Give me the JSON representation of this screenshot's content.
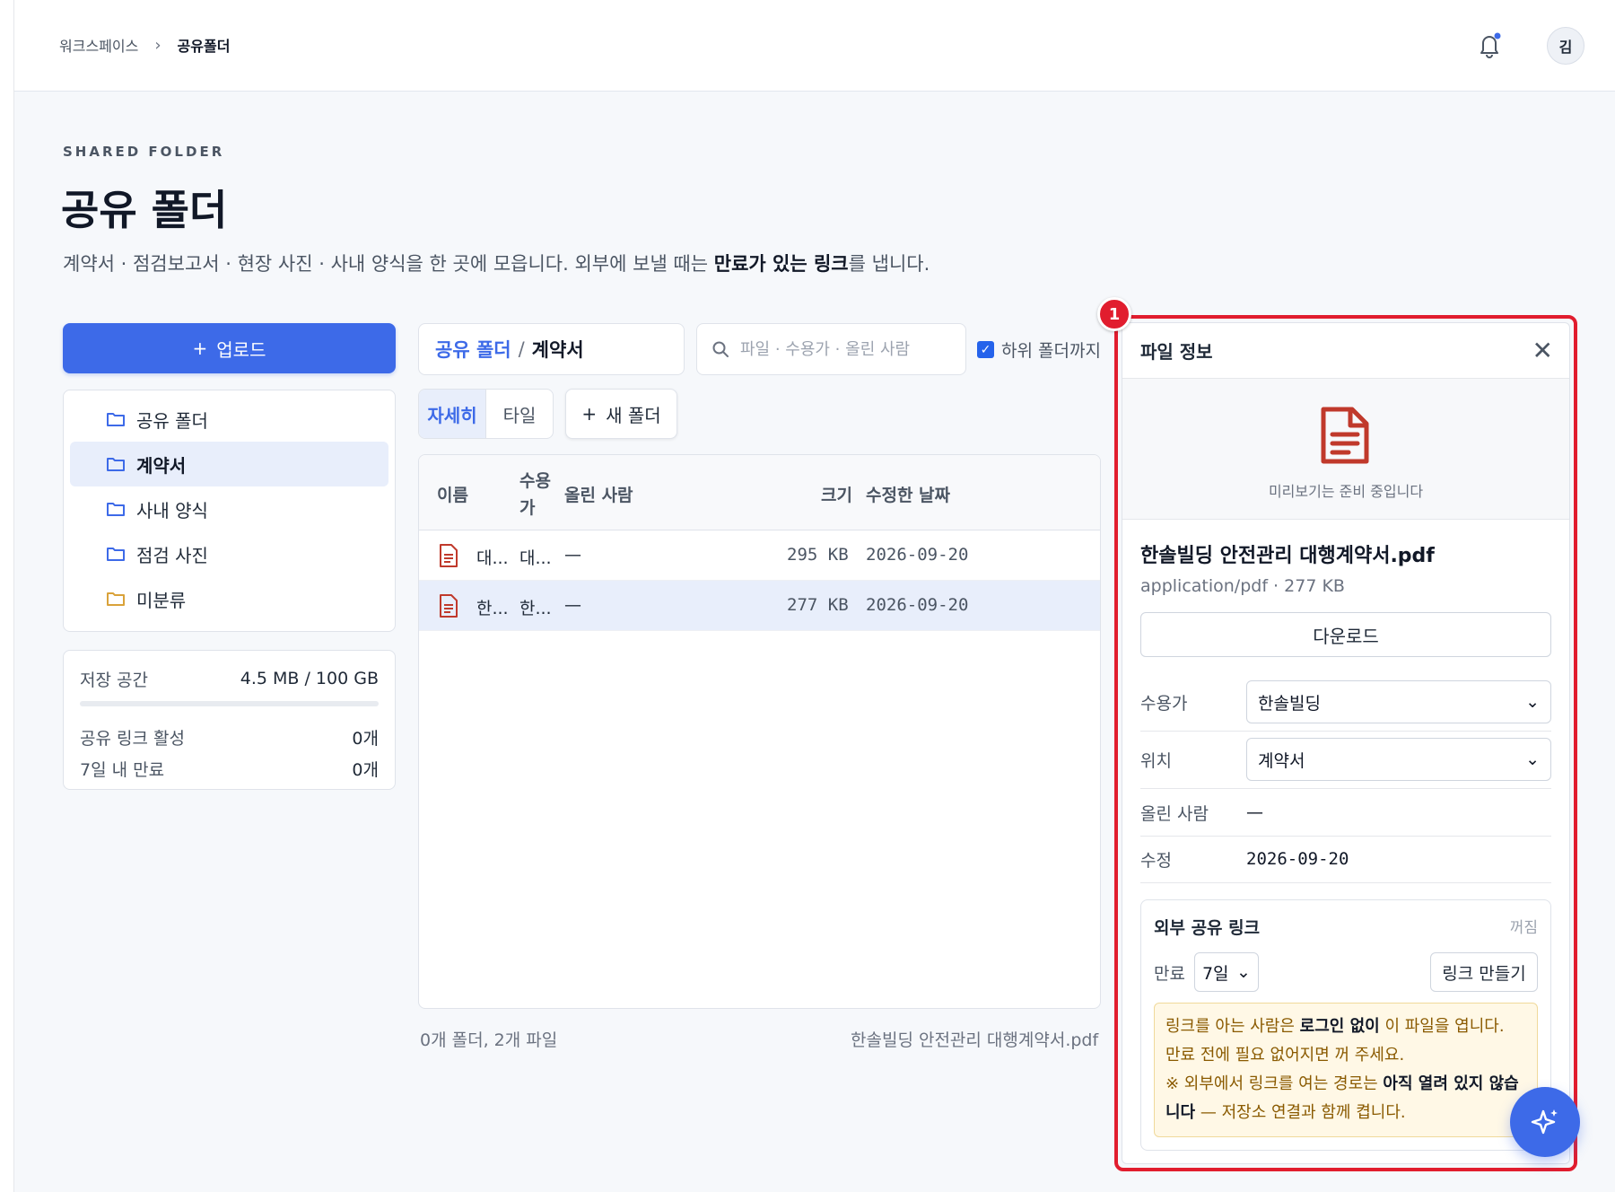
{
  "breadcrumb": {
    "root": "워크스페이스",
    "separator": "›",
    "current": "공유폴더"
  },
  "user": {
    "avatar_initial": "김"
  },
  "header": {
    "eyebrow": "SHARED FOLDER",
    "title": "공유 폴더",
    "desc_prefix": "계약서 · 점검보고서 · 현장 사진 · 사내 양식을 한 곳에 모읍니다. 외부에 보낼 때는 ",
    "desc_bold": "만료가 있는 링크",
    "desc_suffix": "를 냅니다."
  },
  "sidebar": {
    "upload_label": "업로드",
    "folders": [
      {
        "label": "공유 폴더",
        "active": false,
        "color": "#3d6ae8"
      },
      {
        "label": "계약서",
        "active": true,
        "color": "#3d6ae8"
      },
      {
        "label": "사내 양식",
        "active": false,
        "color": "#3d6ae8"
      },
      {
        "label": "점검 사진",
        "active": false,
        "color": "#3d6ae8"
      },
      {
        "label": "미분류",
        "active": false,
        "color": "#d9a23a"
      }
    ],
    "storage": {
      "label": "저장 공간",
      "value": "4.5 MB / 100 GB",
      "used_fraction": 4.5e-05,
      "active_links_label": "공유 링크 활성",
      "active_links_value": "0개",
      "expiring_label": "7일 내 만료",
      "expiring_value": "0개"
    }
  },
  "toolbar": {
    "path_root": "공유 폴더",
    "path_sep": "/",
    "path_current": "계약서",
    "search_placeholder": "파일 · 수용가 · 올린 사람",
    "include_subfolders_label": "하위 폴더까지",
    "include_subfolders_checked": true,
    "view_detail": "자세히",
    "view_tile": "타일",
    "new_folder": "새 폴더"
  },
  "table": {
    "columns": {
      "name": "이름",
      "customer_1": "수용",
      "customer_2": "가",
      "uploader": "올린 사람",
      "size": "크기",
      "modified": "수정한 날짜"
    },
    "rows": [
      {
        "name": "대...",
        "customer": "대...",
        "uploader": "—",
        "size": "295 KB",
        "modified": "2026-09-20",
        "selected": false
      },
      {
        "name": "한...",
        "customer": "한...",
        "uploader": "—",
        "size": "277 KB",
        "modified": "2026-09-20",
        "selected": true
      }
    ],
    "footer_count": "0개 폴더, 2개 파일",
    "footer_selected": "한솔빌딩 안전관리 대행계약서.pdf"
  },
  "panel": {
    "badge": "1",
    "title": "파일 정보",
    "preview_text": "미리보기는 준비 중입니다",
    "file_name": "한솔빌딩 안전관리 대행계약서.pdf",
    "file_meta": "application/pdf · 277 KB",
    "download_label": "다운로드",
    "customer_label": "수용가",
    "customer_value": "한솔빌딩",
    "location_label": "위치",
    "location_value": "계약서",
    "uploader_label": "올린 사람",
    "uploader_value": "—",
    "modified_label": "수정",
    "modified_value": "2026-09-20",
    "share": {
      "title": "외부 공유 링크",
      "status": "꺼짐",
      "expiry_label": "만료",
      "expiry_value": "7일",
      "make_link": "링크 만들기",
      "warn_1a": "링크를 아는 사람은 ",
      "warn_1b": "로그인 없이",
      "warn_1c": " 이 파일을 엽니다.",
      "warn_2": "만료 전에 필요 없어지면 꺼 주세요.",
      "warn_3a": "※ 외부에서 링크를 여는 경로는 ",
      "warn_3b": "아직 열려 있지 않습니다",
      "warn_3c": " — 저장소 연결과 함께 켭니다."
    }
  },
  "colors": {
    "accent": "#3d6ae8",
    "highlight": "#e11d2e",
    "pdf": "#c0392b"
  }
}
